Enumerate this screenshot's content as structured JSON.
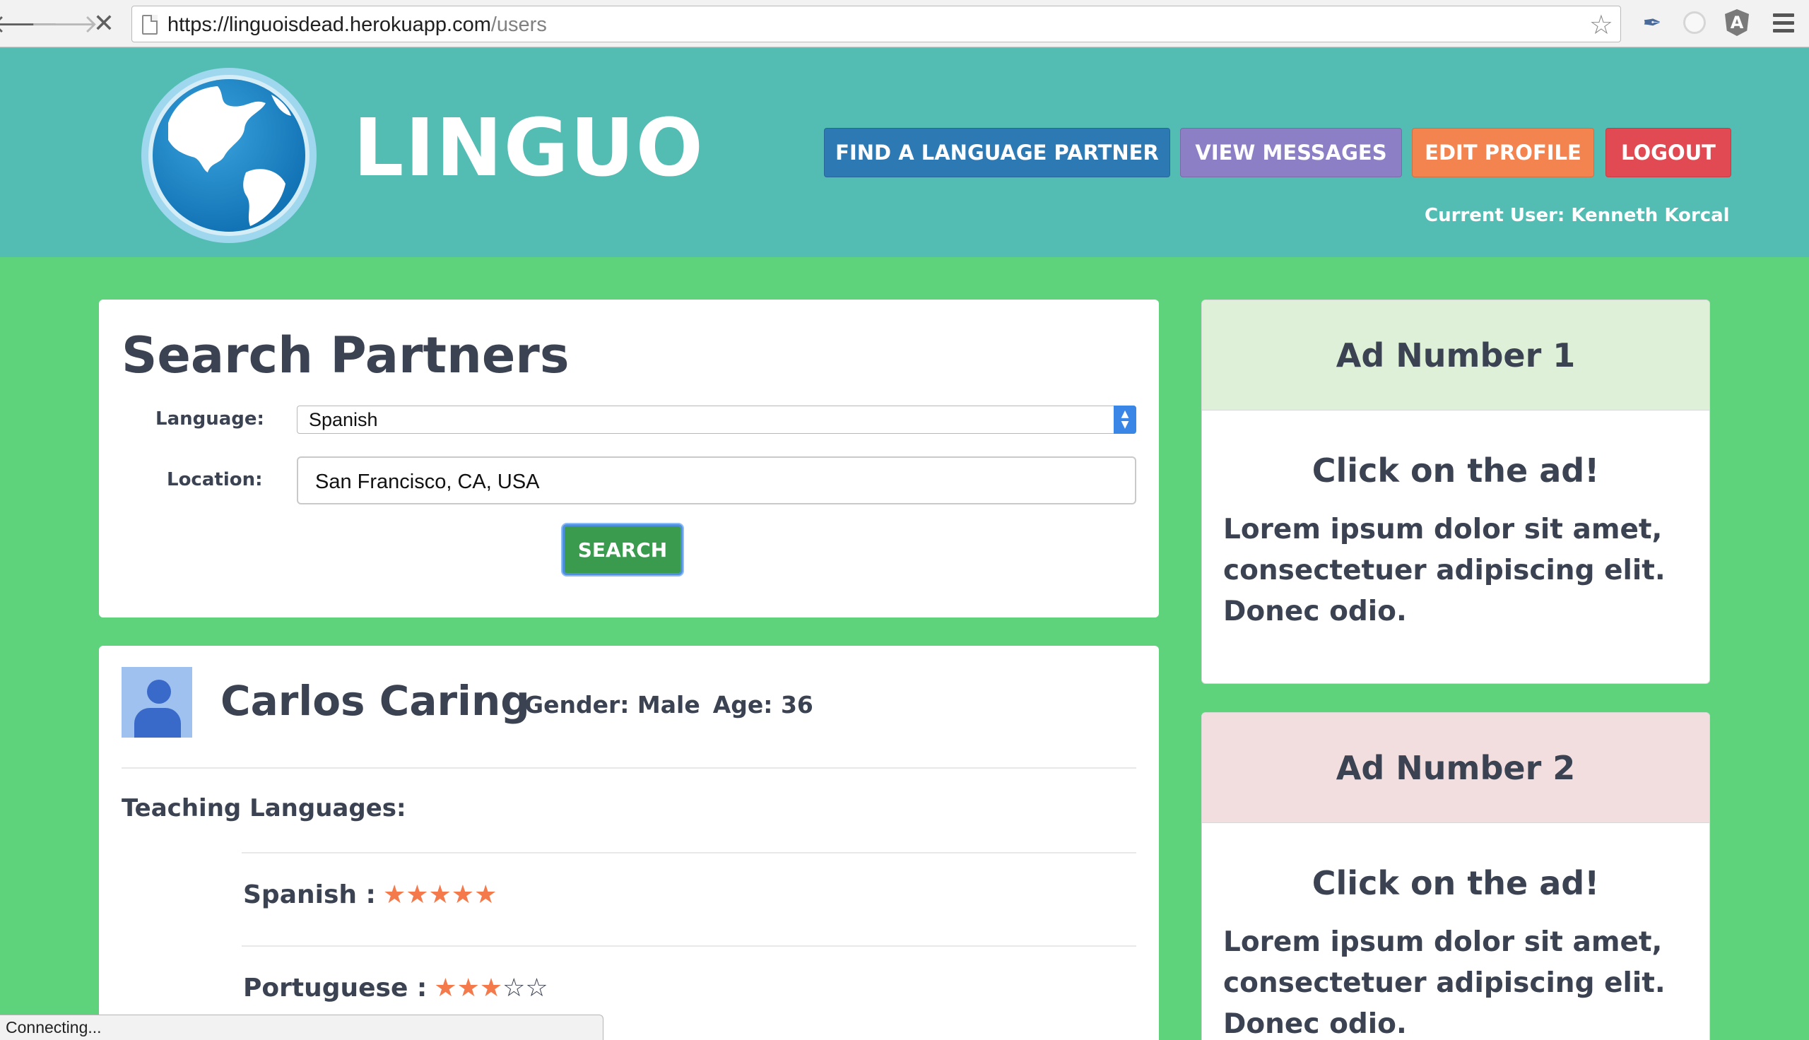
{
  "browser": {
    "url_domain": "https://linguoisdead.herokuapp.com",
    "url_path": "/users",
    "back_glyph": "🡐",
    "forward_glyph": "🡒",
    "stop_glyph": "✕",
    "star_glyph": "☆",
    "dropper_glyph": "✒",
    "angular_glyph": "A"
  },
  "header": {
    "brand": "LINGUO",
    "nav": {
      "find": "FIND A LANGUAGE PARTNER",
      "messages": "VIEW MESSAGES",
      "edit": "EDIT PROFILE",
      "logout": "LOGOUT"
    },
    "current_user": "Current User: Kenneth Korcal"
  },
  "search": {
    "title": "Search Partners",
    "language_label": "Language:",
    "language_value": "Spanish",
    "location_label": "Location:",
    "location_value": "San Francisco, CA, USA",
    "button": "SEARCH"
  },
  "profile": {
    "name": "Carlos Caring",
    "gender": "Gender: Male",
    "age": "Age: 36",
    "teaching_title": "Teaching Languages:",
    "languages": [
      {
        "label": "Spanish :",
        "rating": 5,
        "max": 5
      },
      {
        "label": "Portuguese :",
        "rating": 3,
        "max": 5
      }
    ]
  },
  "ads": [
    {
      "title": "Ad Number 1",
      "subtitle": "Click on the ad!",
      "body": "Lorem ipsum dolor sit amet, consectetuer adipiscing elit. Donec odio."
    },
    {
      "title": "Ad Number 2",
      "subtitle": "Click on the ad!",
      "body": "Lorem ipsum dolor sit amet, consectetuer adipiscing elit. Donec odio."
    }
  ],
  "status_text": "Connecting...",
  "colors": {
    "page_bg": "#5fd27c",
    "header_bg": "#53bdb3",
    "find_btn": "#2d79b4",
    "messages_btn": "#8c7fc6",
    "edit_btn": "#f4844f",
    "logout_btn": "#e14a52",
    "search_btn": "#3a9a4e",
    "star_color": "#f47a4c"
  }
}
